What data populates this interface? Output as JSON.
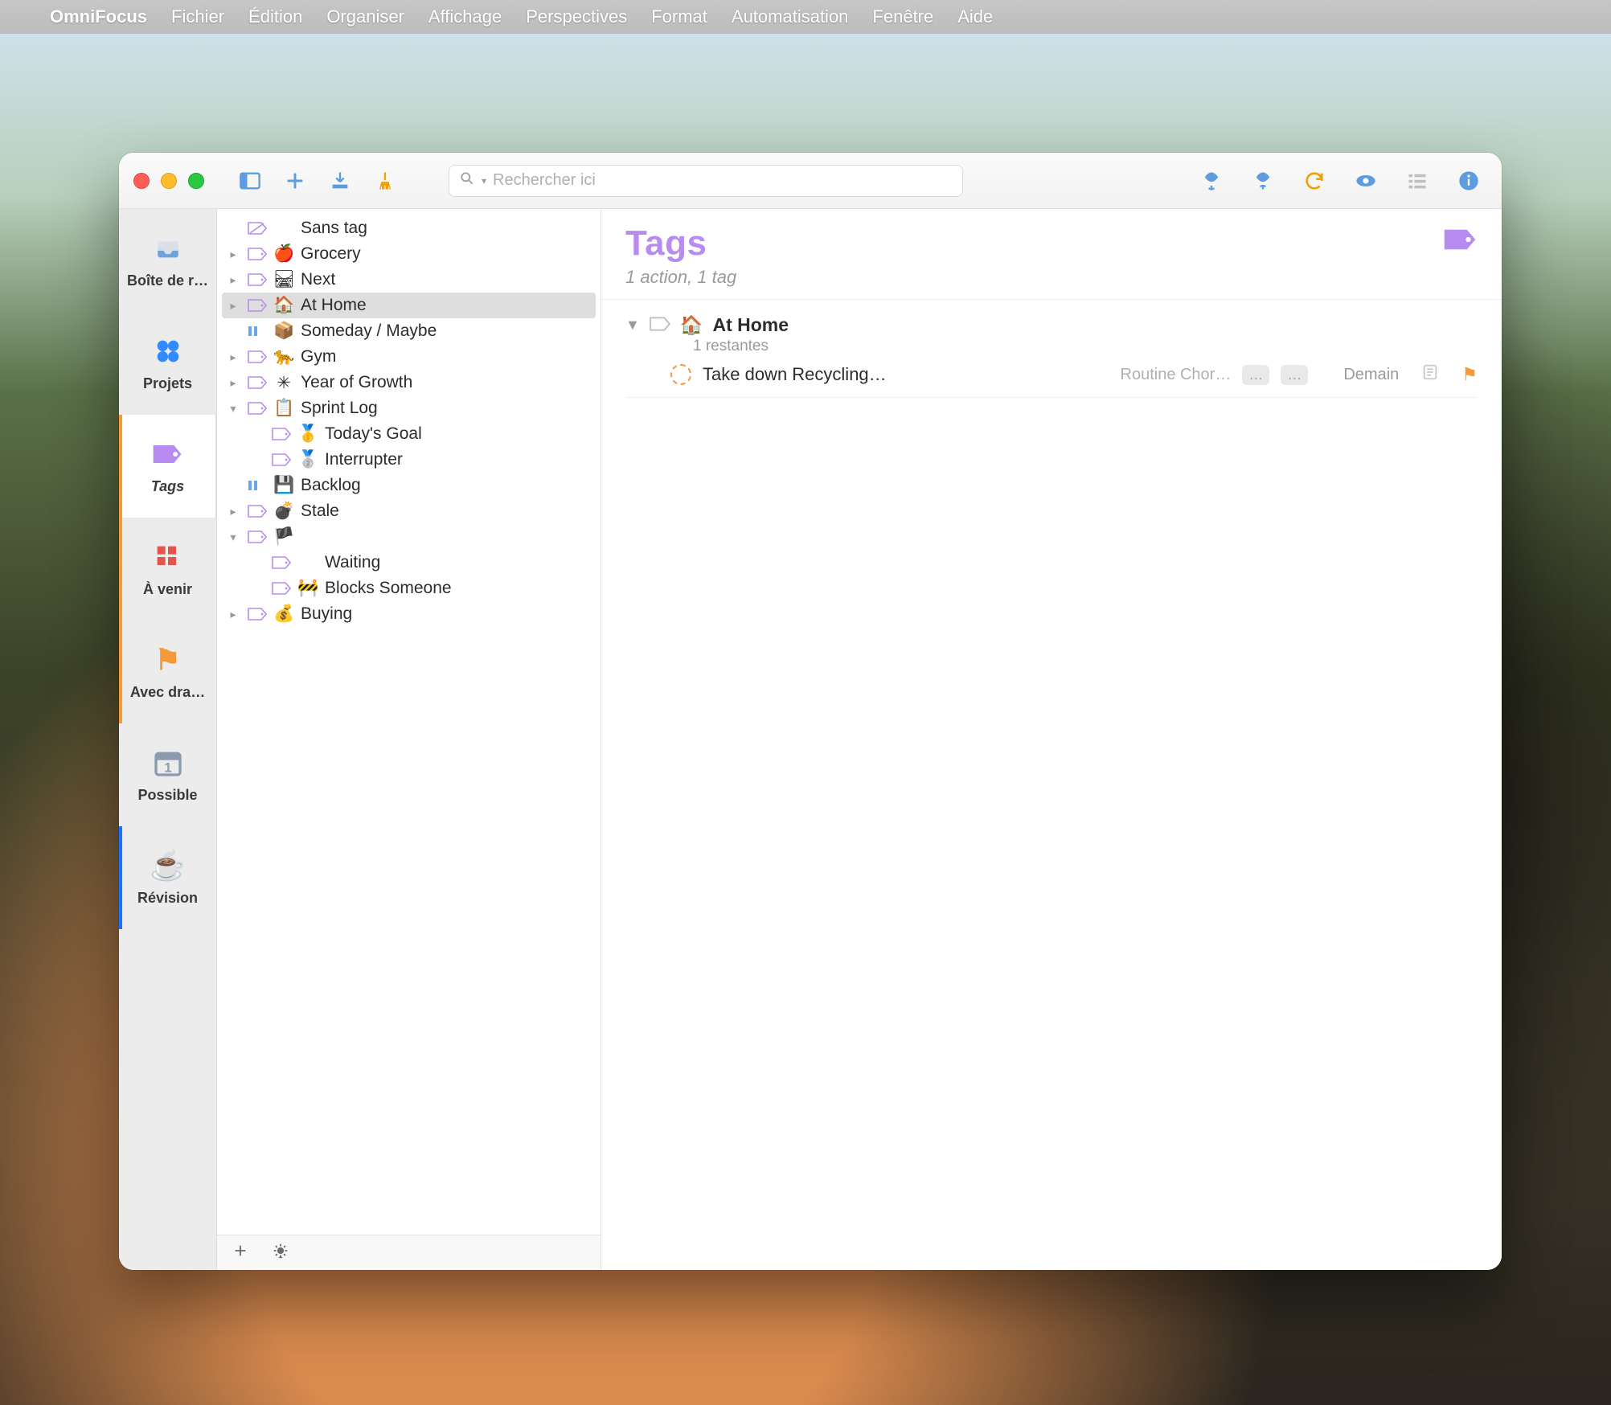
{
  "menubar": {
    "app": "OmniFocus",
    "items": [
      "Fichier",
      "Édition",
      "Organiser",
      "Affichage",
      "Perspectives",
      "Format",
      "Automatisation",
      "Fenêtre",
      "Aide"
    ]
  },
  "toolbar": {
    "search_placeholder": "Rechercher ici"
  },
  "rail": [
    {
      "key": "inbox",
      "label": "Boîte de r…",
      "icon": "📥",
      "color": "#5e9ce0"
    },
    {
      "key": "projects",
      "label": "Projets",
      "icon": "⬣",
      "color": "#2f8bff"
    },
    {
      "key": "tags",
      "label": "Tags",
      "icon": "🏷",
      "color": "#b88bf0",
      "selected": true
    },
    {
      "key": "forecast",
      "label": "À venir",
      "icon": "🟥",
      "color": "#e0564a",
      "accent": "orange"
    },
    {
      "key": "flagged",
      "label": "Avec dra…",
      "icon": "🚩",
      "color": "#f49a3b",
      "accent": "orange"
    },
    {
      "key": "possible",
      "label": "Possible",
      "icon": "📅",
      "color": "#8a9bb0"
    },
    {
      "key": "review",
      "label": "Révision",
      "icon": "☕",
      "color": "#1a73ff",
      "accent": "blue"
    }
  ],
  "tree": [
    {
      "label": "Sans tag",
      "emoji": "",
      "kind": "notag",
      "indent": 0,
      "disclose": ""
    },
    {
      "label": "Grocery",
      "emoji": "🍎",
      "kind": "leaf",
      "indent": 0,
      "disclose": "▸"
    },
    {
      "label": "Next",
      "emoji": "🛤",
      "kind": "leaf",
      "indent": 0,
      "disclose": "▸"
    },
    {
      "label": "At Home",
      "emoji": "🏠",
      "kind": "leaf",
      "indent": 0,
      "disclose": "▸",
      "selected": true
    },
    {
      "label": "Someday / Maybe",
      "emoji": "📦",
      "kind": "paused",
      "indent": 0,
      "disclose": ""
    },
    {
      "label": "Gym",
      "emoji": "🐆",
      "kind": "leaf",
      "indent": 0,
      "disclose": "▸"
    },
    {
      "label": "Year of Growth",
      "emoji": "✳",
      "kind": "leaf",
      "indent": 0,
      "disclose": "▸"
    },
    {
      "label": "Sprint Log",
      "emoji": "📋",
      "kind": "open",
      "indent": 0,
      "disclose": "▾"
    },
    {
      "label": "Today's Goal",
      "emoji": "🥇",
      "kind": "leaf",
      "indent": 1,
      "disclose": ""
    },
    {
      "label": "Interrupter",
      "emoji": "🥈",
      "kind": "leaf",
      "indent": 1,
      "disclose": ""
    },
    {
      "label": "Backlog",
      "emoji": "💾",
      "kind": "paused",
      "indent": 0,
      "disclose": ""
    },
    {
      "label": "Stale",
      "emoji": "💣",
      "kind": "leaf",
      "indent": 0,
      "disclose": "▸"
    },
    {
      "label": "",
      "emoji": "🏴",
      "kind": "open",
      "indent": 0,
      "disclose": "▾"
    },
    {
      "label": "Waiting",
      "emoji": "",
      "kind": "leaf",
      "indent": 1,
      "disclose": ""
    },
    {
      "label": "Blocks Someone",
      "emoji": "🚧",
      "kind": "leaf",
      "indent": 1,
      "disclose": ""
    },
    {
      "label": "Buying",
      "emoji": "💰",
      "kind": "leaf",
      "indent": 0,
      "disclose": "▸"
    }
  ],
  "main": {
    "title": "Tags",
    "subtitle": "1 action, 1 tag",
    "section": {
      "emoji": "🏠",
      "name": "At Home",
      "remaining": "1 restantes"
    },
    "task": {
      "title": "Take down Recycling…",
      "project": "Routine Chor…",
      "chip1": "…",
      "chip2": "…",
      "due": "Demain"
    }
  }
}
